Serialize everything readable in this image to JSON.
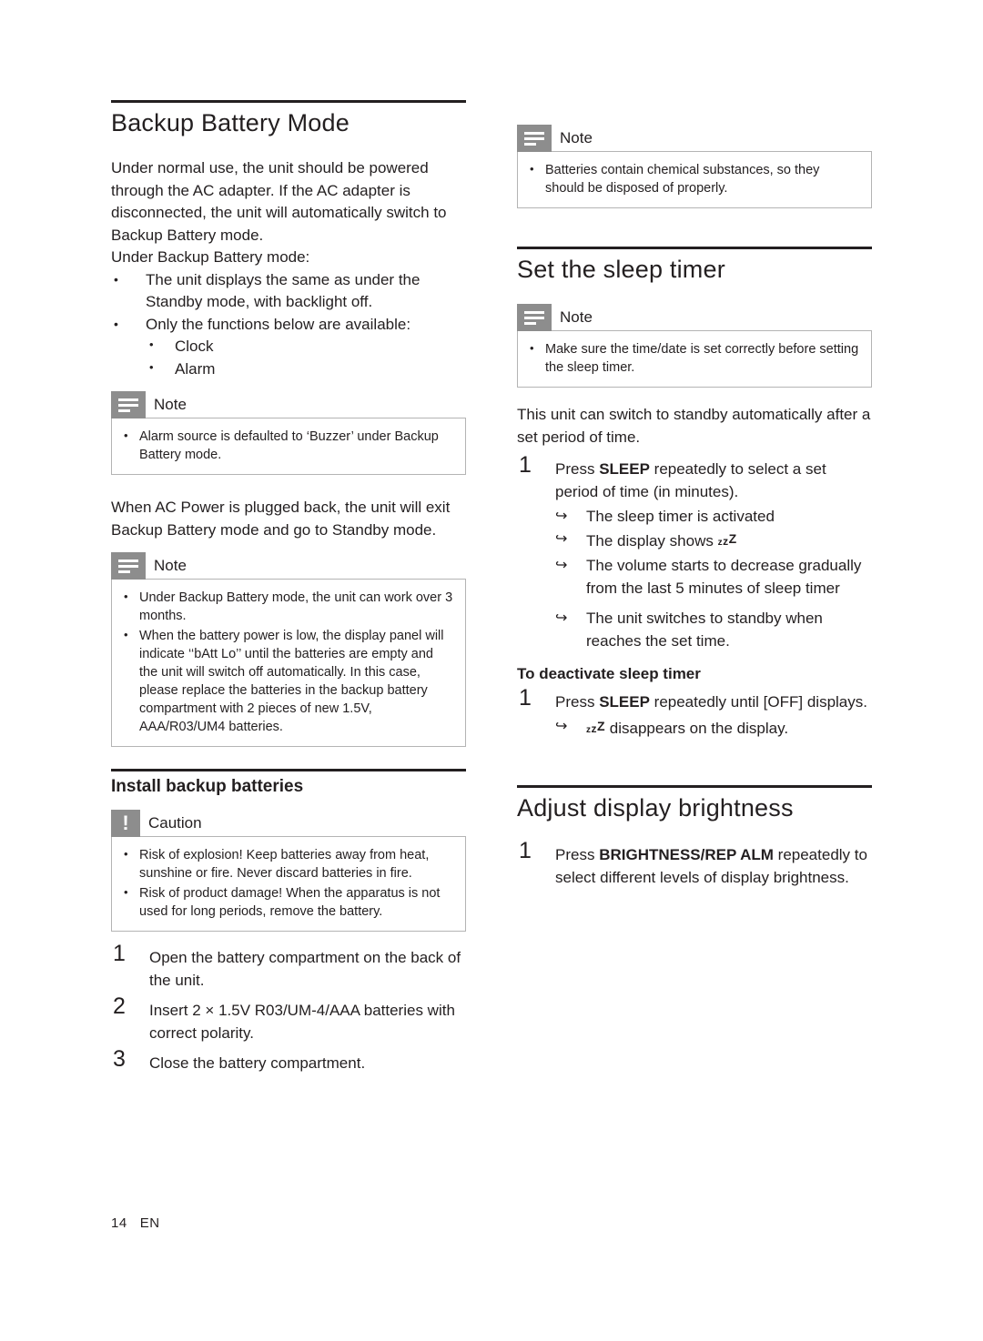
{
  "page": {
    "number": "14",
    "lang": "EN"
  },
  "left": {
    "section1": {
      "title": "Backup Battery Mode",
      "para1": "Under normal use, the unit should be powered through the AC adapter. If the AC adapter is disconnected, the unit will automatically switch to Backup Battery mode.",
      "para2": "Under Backup Battery mode:",
      "bullets": [
        "The unit displays the same as under the Standby mode, with backlight off.",
        "Only the functions below are available:"
      ],
      "subbullets": [
        "Clock",
        "Alarm"
      ],
      "note1": {
        "label": "Note",
        "items": [
          "Alarm source is defaulted to ‘Buzzer’ under Backup Battery mode."
        ]
      },
      "para3": "When AC Power is plugged back, the unit will exit Backup Battery mode and go to Standby mode.",
      "note2": {
        "label": "Note",
        "items": [
          "Under Backup Battery mode, the unit can work over 3 months.",
          "When the battery power is low, the display panel will indicate ‘‘bAtt Lo’’ until the batteries are empty and the unit will switch off automatically. In this case, please replace the batteries in the backup battery compartment with 2 pieces of new 1.5V, AAA/R03/UM4 batteries."
        ]
      }
    },
    "section2": {
      "title": "Install backup batteries",
      "caution": {
        "label": "Caution",
        "items": [
          "Risk of explosion! Keep batteries away from heat, sunshine or fire. Never discard batteries in fire.",
          "Risk of product damage! When the apparatus is not used for long periods, remove the battery."
        ]
      },
      "steps": [
        {
          "num": "1",
          "text": "Open the battery compartment on the back of the unit."
        },
        {
          "num": "2",
          "text": "Insert 2 × 1.5V R03/UM-4/AAA batteries with correct polarity."
        },
        {
          "num": "3",
          "text": "Close the battery compartment."
        }
      ]
    }
  },
  "right": {
    "note_top": {
      "label": "Note",
      "items": [
        "Batteries contain chemical substances, so they should be disposed of properly."
      ]
    },
    "section1": {
      "title": "Set the sleep timer",
      "note": {
        "label": "Note",
        "items": [
          "Make sure the time/date is set correctly before setting the sleep timer."
        ]
      },
      "para1": "This unit can switch to standby automatically after a set period of time.",
      "step1": {
        "num": "1",
        "pre": "Press ",
        "key": "SLEEP",
        "post": " repeatedly to select a set period of time (in minutes)."
      },
      "arrows": [
        {
          "text": "The sleep timer is activated",
          "zzz": false
        },
        {
          "text": "The display shows ",
          "zzz": true
        },
        {
          "text": "The volume starts to decrease gradually from the last 5 minutes of sleep timer",
          "zzz": false
        },
        {
          "text": "The unit switches to standby when reaches the set time.",
          "zzz": false
        }
      ],
      "deactivate": {
        "title": "To deactivate sleep timer",
        "step": {
          "num": "1",
          "pre": "Press ",
          "key": "SLEEP",
          "post": " repeatedly until [OFF] displays."
        },
        "arrow": " disappears on the display."
      }
    },
    "section2": {
      "title": "Adjust display brightness",
      "step": {
        "num": "1",
        "pre": "Press ",
        "key": "BRIGHTNESS/REP ALM",
        "post": " repeatedly to select different levels of display brightness."
      }
    }
  }
}
